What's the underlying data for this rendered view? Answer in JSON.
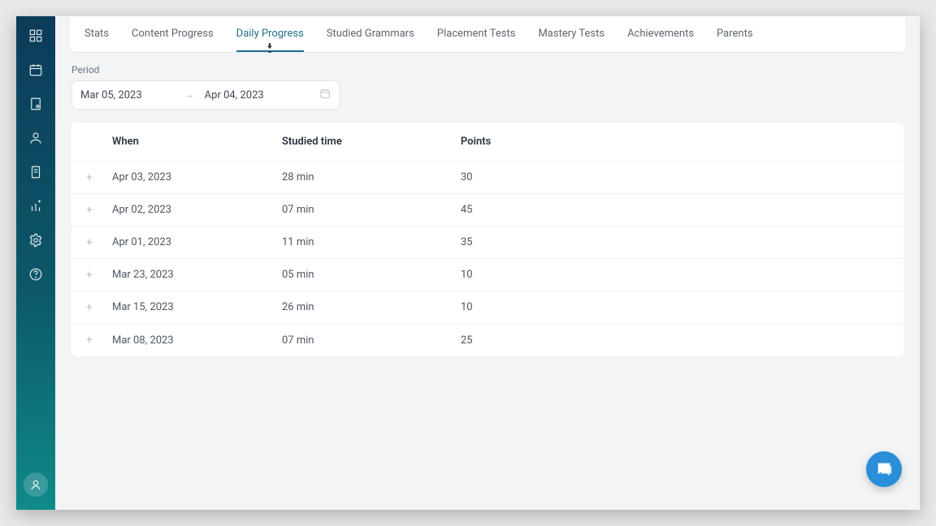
{
  "sidebar": {
    "items": [
      {
        "name": "dashboard-icon"
      },
      {
        "name": "calendar-icon"
      },
      {
        "name": "book-icon"
      },
      {
        "name": "user-icon"
      },
      {
        "name": "notes-icon"
      },
      {
        "name": "chart-add-icon"
      },
      {
        "name": "settings-icon"
      },
      {
        "name": "help-icon"
      }
    ]
  },
  "tabs": [
    {
      "label": "Stats",
      "active": false
    },
    {
      "label": "Content Progress",
      "active": false
    },
    {
      "label": "Daily Progress",
      "active": true
    },
    {
      "label": "Studied Grammars",
      "active": false
    },
    {
      "label": "Placement Tests",
      "active": false
    },
    {
      "label": "Mastery Tests",
      "active": false
    },
    {
      "label": "Achievements",
      "active": false
    },
    {
      "label": "Parents",
      "active": false
    }
  ],
  "period": {
    "label": "Period",
    "from": "Mar 05, 2023",
    "to": "Apr 04, 2023"
  },
  "table": {
    "headers": {
      "when": "When",
      "studied_time": "Studied time",
      "points": "Points"
    },
    "rows": [
      {
        "when": "Apr 03, 2023",
        "time": "28 min",
        "points": "30"
      },
      {
        "when": "Apr 02, 2023",
        "time": "07 min",
        "points": "45"
      },
      {
        "when": "Apr 01, 2023",
        "time": "11 min",
        "points": "35"
      },
      {
        "when": "Mar 23, 2023",
        "time": "05 min",
        "points": "10"
      },
      {
        "when": "Mar 15, 2023",
        "time": "26 min",
        "points": "10"
      },
      {
        "when": "Mar 08, 2023",
        "time": "07 min",
        "points": "25"
      }
    ]
  },
  "expand_symbol": "+"
}
